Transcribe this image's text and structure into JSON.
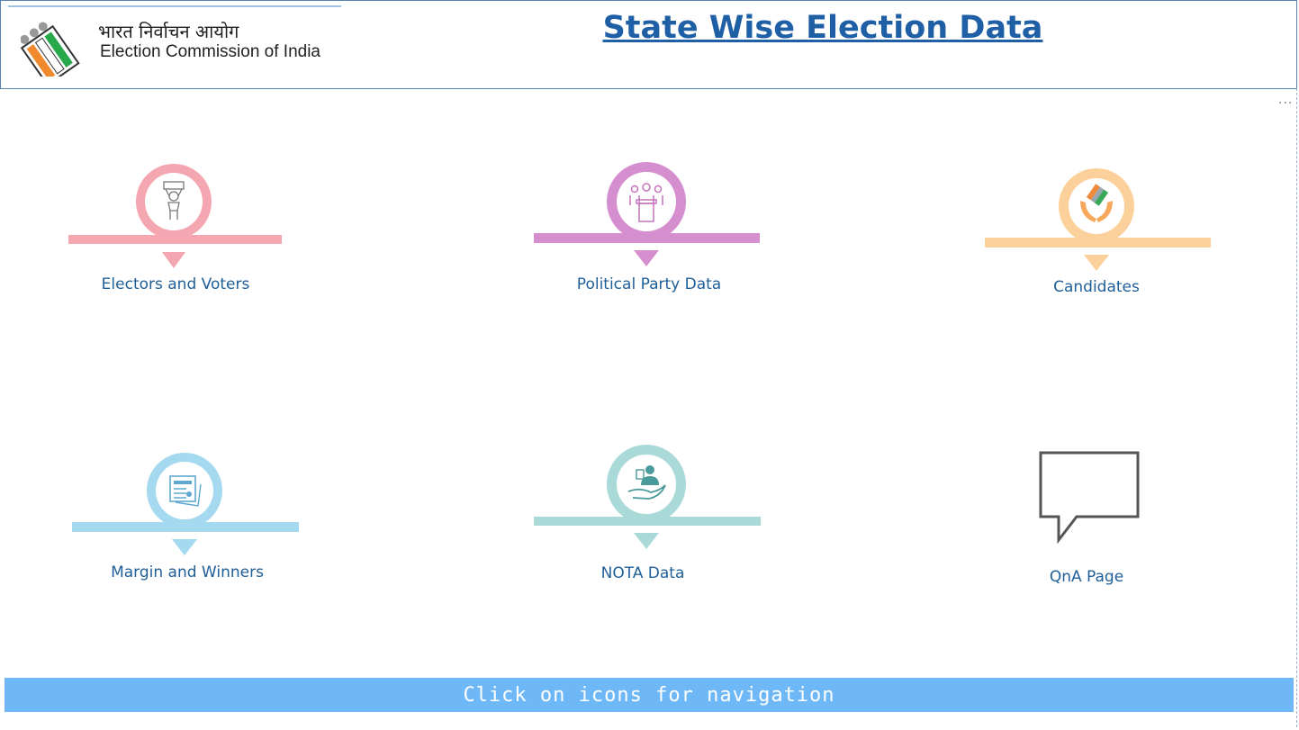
{
  "header": {
    "logo_hindi": "भारत निर्वाचन आयोग",
    "logo_english": "Election Commission of India",
    "title": "State Wise Election Data"
  },
  "more_options": "...",
  "nav_tiles": [
    {
      "label": "Electors and Voters",
      "icon": "voter-icon",
      "color": "#f4a7b0"
    },
    {
      "label": "Political Party Data",
      "icon": "podium-icon",
      "color": "#d58fcf"
    },
    {
      "label": "Candidates",
      "icon": "hands-ballot-icon",
      "color": "#fcd09a"
    },
    {
      "label": "Margin and Winners",
      "icon": "ballot-paper-icon",
      "color": "#a4d9f0"
    },
    {
      "label": "NOTA Data",
      "icon": "hand-person-icon",
      "color": "#a9dad8"
    },
    {
      "label": "QnA Page",
      "icon": "speech-bubble-icon",
      "color": "#555555"
    }
  ],
  "footer": {
    "text": "Click on icons for navigation"
  }
}
